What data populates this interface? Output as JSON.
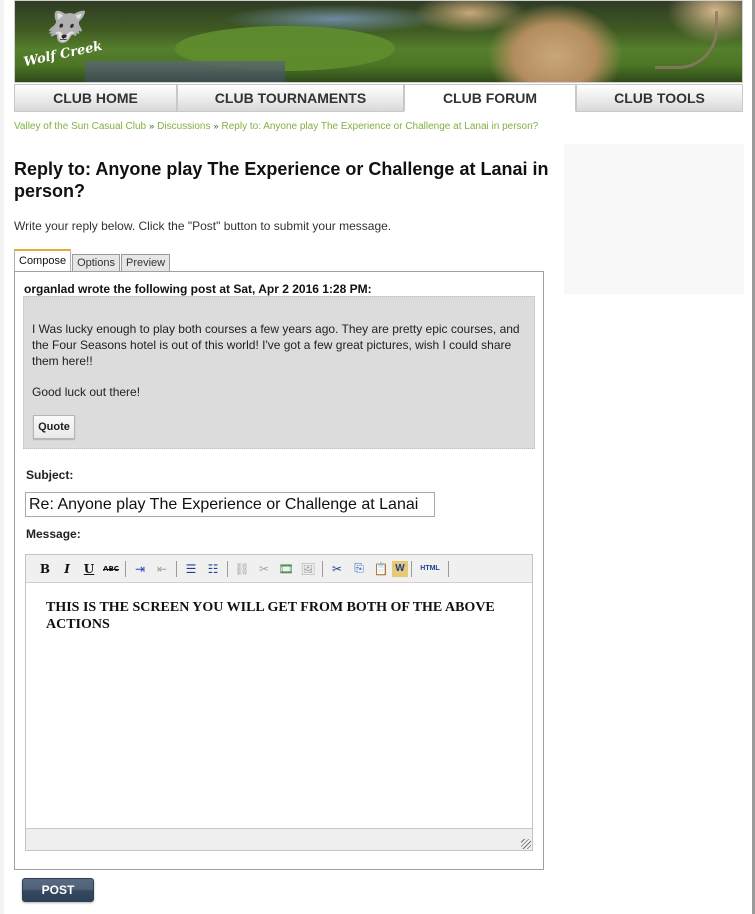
{
  "header": {
    "logo_text": "Wolf Creek",
    "logo_icon": "wolf-head-icon"
  },
  "nav": {
    "items": [
      {
        "label": "CLUB HOME",
        "active": false
      },
      {
        "label": "CLUB TOURNAMENTS",
        "active": false
      },
      {
        "label": "CLUB FORUM",
        "active": true
      },
      {
        "label": "CLUB TOOLS",
        "active": false
      }
    ]
  },
  "breadcrumb": {
    "items": [
      "Valley of the Sun Casual Club",
      "Discussions",
      "Reply to: Anyone play The Experience or Challenge at Lanai in person?"
    ],
    "separator": "»"
  },
  "page": {
    "title": "Reply to: Anyone play The Experience or Challenge at Lanai in person?",
    "intro": "Write your reply below. Click the \"Post\" button to submit your message."
  },
  "tabs": [
    {
      "label": "Compose",
      "active": true
    },
    {
      "label": "Options",
      "active": false
    },
    {
      "label": "Preview",
      "active": false
    }
  ],
  "quoted_post": {
    "header": "organlad wrote the following post at Sat, Apr 2 2016 1:28 PM:",
    "paragraphs": [
      "I Was lucky enough to play both courses a few years ago. They are pretty epic courses, and the Four Seasons hotel is out of this world! I've got a few great pictures, wish I could share them here!!",
      "Good luck out there!"
    ],
    "quote_button": "Quote"
  },
  "form": {
    "subject_label": "Subject:",
    "subject_value": "Re: Anyone play The Experience or Challenge at Lanai",
    "message_label": "Message:",
    "message_content": "THIS IS THE SCREEN YOU WILL GET FROM BOTH OF THE ABOVE ACTIONS"
  },
  "toolbar": {
    "buttons": [
      {
        "icon": "bold-icon",
        "glyph": "B"
      },
      {
        "icon": "italic-icon",
        "glyph": "I"
      },
      {
        "icon": "underline-icon",
        "glyph": "U"
      },
      {
        "icon": "strikethrough-icon",
        "glyph": "ABC"
      },
      {
        "icon": "indent-icon",
        "glyph": "⇥"
      },
      {
        "icon": "outdent-icon",
        "glyph": "⇤"
      },
      {
        "icon": "bullet-list-icon",
        "glyph": "☰"
      },
      {
        "icon": "numbered-list-icon",
        "glyph": "☷"
      },
      {
        "icon": "link-icon",
        "glyph": "⛓"
      },
      {
        "icon": "unlink-icon",
        "glyph": "✂"
      },
      {
        "icon": "insert-media-icon",
        "glyph": "🎞"
      },
      {
        "icon": "insert-image-icon",
        "glyph": "🖼"
      },
      {
        "icon": "cut-icon",
        "glyph": "✂"
      },
      {
        "icon": "copy-icon",
        "glyph": "⎘"
      },
      {
        "icon": "paste-icon",
        "glyph": "📋"
      },
      {
        "icon": "paste-from-word-icon",
        "glyph": "W"
      },
      {
        "icon": "html-icon",
        "glyph": "HTML"
      }
    ]
  },
  "actions": {
    "post_label": "POST"
  },
  "colors": {
    "breadcrumb_link": "#7fb23f",
    "active_tab_accent": "#e8a93a",
    "post_button": "#3a4d66",
    "quote_background": "#dcdcdc"
  }
}
